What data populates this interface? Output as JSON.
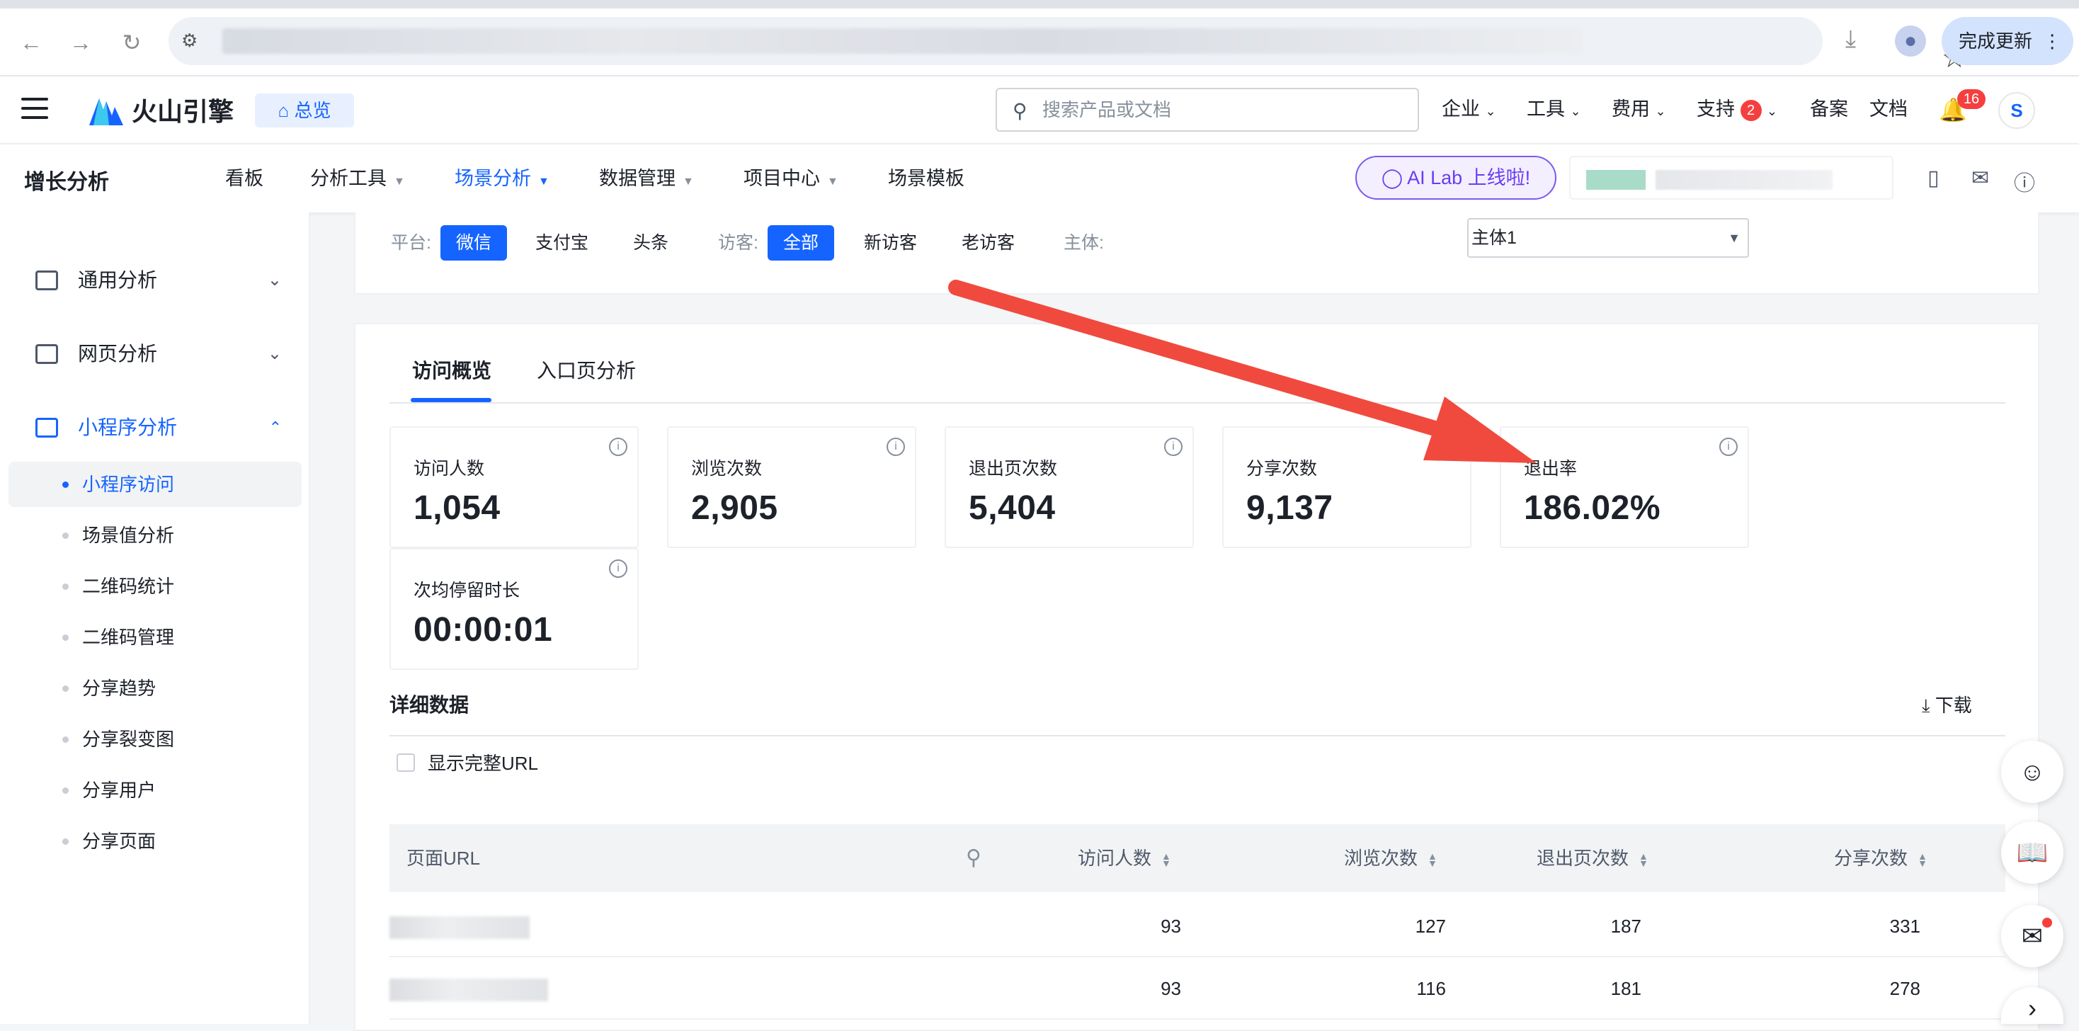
{
  "browser": {
    "update_label": "完成更新",
    "back_icon": "arrow-left-icon",
    "forward_icon": "arrow-right-icon",
    "reload_icon": "reload-icon"
  },
  "topnav": {
    "logo_text": "火山引擎",
    "overview_label": "总览",
    "search_placeholder": "搜索产品或文档",
    "menus": {
      "enterprise": "企业",
      "tools": "工具",
      "cost": "费用",
      "support": "支持",
      "filing": "备案",
      "docs": "文档"
    },
    "support_badge": "2",
    "notification_count": "16",
    "avatar_letter": "S"
  },
  "prodnav": {
    "title": "增长分析",
    "items": {
      "board": "看板",
      "tools": "分析工具",
      "scene": "场景分析",
      "data": "数据管理",
      "project": "项目中心",
      "template": "场景模板"
    },
    "ailab": "AI Lab 上线啦!"
  },
  "sidebar": {
    "groups": {
      "general": "通用分析",
      "web": "网页分析",
      "miniapp": "小程序分析"
    },
    "items": [
      "小程序访问",
      "场景值分析",
      "二维码统计",
      "二维码管理",
      "分享趋势",
      "分享裂变图",
      "分享用户",
      "分享页面"
    ]
  },
  "filters": {
    "platform_label": "平台:",
    "platforms": [
      "微信",
      "支付宝",
      "头条"
    ],
    "visitor_label": "访客:",
    "visitors": [
      "全部",
      "新访客",
      "老访客"
    ],
    "entity_label": "主体:",
    "entity_value": "主体1"
  },
  "tabs": [
    "访问概览",
    "入口页分析"
  ],
  "metrics": [
    {
      "label": "访问人数",
      "value": "1,054"
    },
    {
      "label": "浏览次数",
      "value": "2,905"
    },
    {
      "label": "退出页次数",
      "value": "5,404"
    },
    {
      "label": "分享次数",
      "value": "9,137"
    },
    {
      "label": "退出率",
      "value": "186.02%"
    },
    {
      "label": "次均停留时长",
      "value": "00:00:01"
    }
  ],
  "detail": {
    "title": "详细数据",
    "download": "下载",
    "show_full_url": "显示完整URL"
  },
  "table": {
    "headers": [
      "页面URL",
      "访问人数",
      "浏览次数",
      "退出页次数",
      "分享次数"
    ],
    "rows": [
      [
        "93",
        "127",
        "187",
        "331"
      ],
      [
        "93",
        "116",
        "181",
        "278"
      ]
    ]
  },
  "colors": {
    "accent": "#1664ff",
    "annotation_arrow": "#f04a3e",
    "badge": "#f53f3f"
  }
}
